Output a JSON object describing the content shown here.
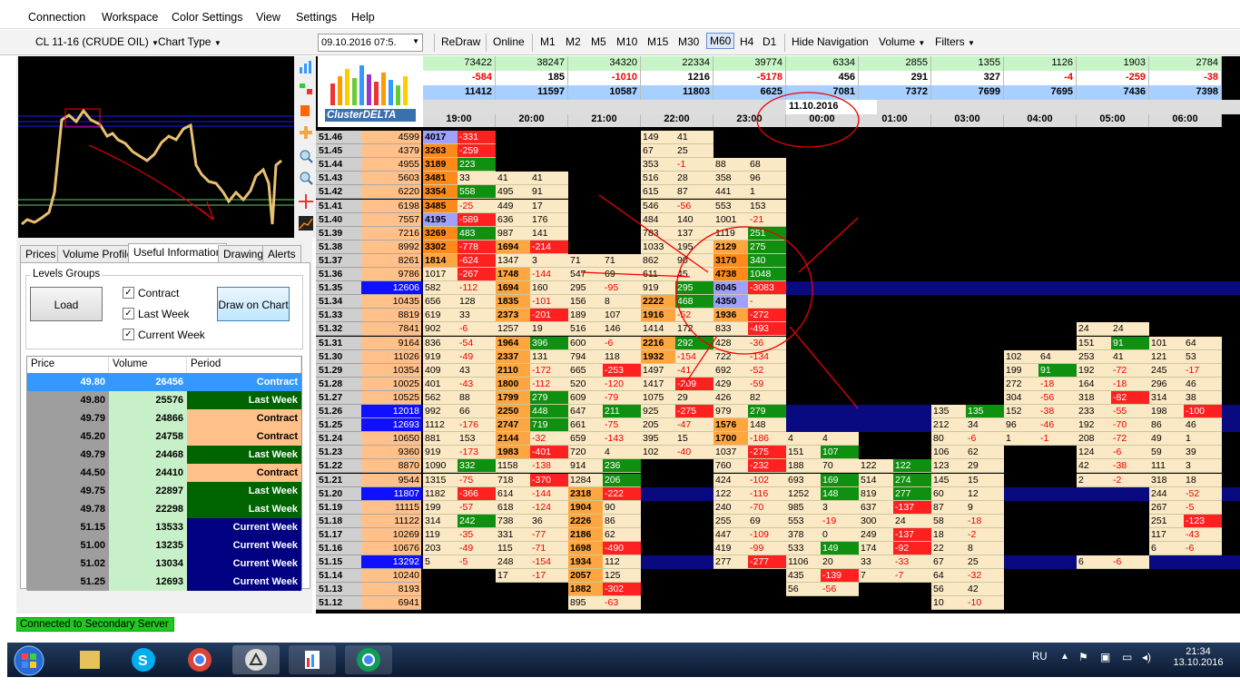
{
  "menu": [
    "Connection",
    "Workspace",
    "Color Settings",
    "View",
    "Settings",
    "Help"
  ],
  "toolbar": {
    "instrument": "CL 11-16 (CRUDE OIL)",
    "chart_type": "Chart Type",
    "date": "09.10.2016 07:5.",
    "redraw": "ReDraw",
    "online": "Online",
    "timeframes": [
      "M1",
      "M2",
      "M5",
      "M10",
      "M15",
      "M30",
      "M60",
      "H4",
      "D1"
    ],
    "hide_nav": "Hide Navigation",
    "volume": "Volume",
    "filters": "Filters"
  },
  "tabs": [
    "Prices",
    "Volume Profile",
    "Useful Information",
    "Drawing",
    "Alerts"
  ],
  "levels": {
    "group_label": "Levels Groups",
    "load": "Load",
    "draw": "Draw on Chart",
    "checks": [
      "Contract",
      "Last Week",
      "Current Week"
    ],
    "headers": [
      "Price",
      "Volume",
      "Period"
    ],
    "rows": [
      {
        "price": "49.80",
        "volume": "26456",
        "period": "Contract",
        "sel": true
      },
      {
        "price": "49.80",
        "volume": "25576",
        "period": "Last Week"
      },
      {
        "price": "49.79",
        "volume": "24866",
        "period": "Contract"
      },
      {
        "price": "45.20",
        "volume": "24758",
        "period": "Contract"
      },
      {
        "price": "49.79",
        "volume": "24468",
        "period": "Last Week"
      },
      {
        "price": "44.50",
        "volume": "24410",
        "period": "Contract"
      },
      {
        "price": "49.75",
        "volume": "22897",
        "period": "Last Week"
      },
      {
        "price": "49.78",
        "volume": "22298",
        "period": "Last Week"
      },
      {
        "price": "51.15",
        "volume": "13533",
        "period": "Current Week"
      },
      {
        "price": "51.00",
        "volume": "13235",
        "period": "Current Week"
      },
      {
        "price": "51.02",
        "volume": "13034",
        "period": "Current Week"
      },
      {
        "price": "51.25",
        "volume": "12693",
        "period": "Current Week"
      }
    ]
  },
  "status": "Connected to Secondary Server",
  "logo": "ClusterDELTA",
  "header": {
    "vol": [
      "73422",
      "38247",
      "34320",
      "22334",
      "39774",
      "6334",
      "2855",
      "1355",
      "1126",
      "1903",
      "2784"
    ],
    "delta": [
      "-584",
      "185",
      "-1010",
      "1216",
      "-5178",
      "456",
      "291",
      "327",
      "-4",
      "-259",
      "-38"
    ],
    "cum": [
      "11412",
      "11597",
      "10587",
      "11803",
      "6625",
      "7081",
      "7372",
      "7699",
      "7695",
      "7436",
      "7398"
    ],
    "date": "11.10.2016",
    "times": [
      "19:00",
      "20:00",
      "21:00",
      "22:00",
      "23:00",
      "00:00",
      "01:00",
      "03:00",
      "04:00",
      "05:00",
      "06:00"
    ]
  },
  "rows": [
    {
      "p": "51.46",
      "v": "4599"
    },
    {
      "p": "51.45",
      "v": "4379"
    },
    {
      "p": "51.44",
      "v": "4955"
    },
    {
      "p": "51.43",
      "v": "5603"
    },
    {
      "p": "51.42",
      "v": "6220"
    },
    {
      "p": "51.41",
      "v": "6198"
    },
    {
      "p": "51.40",
      "v": "7557"
    },
    {
      "p": "51.39",
      "v": "7216"
    },
    {
      "p": "51.38",
      "v": "8992"
    },
    {
      "p": "51.37",
      "v": "8261"
    },
    {
      "p": "51.36",
      "v": "9786"
    },
    {
      "p": "51.35",
      "v": "12606"
    },
    {
      "p": "51.34",
      "v": "10435"
    },
    {
      "p": "51.33",
      "v": "8819"
    },
    {
      "p": "51.32",
      "v": "7841"
    },
    {
      "p": "51.31",
      "v": "9164"
    },
    {
      "p": "51.30",
      "v": "11026"
    },
    {
      "p": "51.29",
      "v": "10354"
    },
    {
      "p": "51.28",
      "v": "10025"
    },
    {
      "p": "51.27",
      "v": "10525"
    },
    {
      "p": "51.26",
      "v": "12018"
    },
    {
      "p": "51.25",
      "v": "12693"
    },
    {
      "p": "51.24",
      "v": "10650"
    },
    {
      "p": "51.23",
      "v": "9360"
    },
    {
      "p": "51.22",
      "v": "8870"
    },
    {
      "p": "51.21",
      "v": "9544"
    },
    {
      "p": "51.20",
      "v": "11807"
    },
    {
      "p": "51.19",
      "v": "11115"
    },
    {
      "p": "51.18",
      "v": "11122"
    },
    {
      "p": "51.17",
      "v": "10269"
    },
    {
      "p": "51.16",
      "v": "10676"
    },
    {
      "p": "51.15",
      "v": "13292"
    },
    {
      "p": "51.14",
      "v": "10240"
    },
    {
      "p": "51.13",
      "v": "8193"
    },
    {
      "p": "51.12",
      "v": "6941"
    }
  ],
  "cells": [
    [
      [
        "4017",
        "-331"
      ],
      [
        "3263",
        "-259"
      ],
      [
        "3189",
        "223"
      ],
      [
        "3481",
        "33"
      ],
      [
        "3354",
        "558"
      ],
      [
        "3485",
        "-25"
      ],
      [
        "4195",
        "-589"
      ],
      [
        "3269",
        "483"
      ],
      [
        "3302",
        "-778"
      ],
      [
        "1814",
        "-624"
      ],
      [
        "1017",
        "-267"
      ],
      [
        "582",
        "-112"
      ],
      [
        "656",
        "128"
      ],
      [
        "619",
        "33"
      ],
      [
        "902",
        "-6"
      ],
      [
        "836",
        "-54"
      ],
      [
        "919",
        "-49"
      ],
      [
        "409",
        "43"
      ],
      [
        "401",
        "-43"
      ],
      [
        "562",
        "88"
      ],
      [
        "992",
        "66"
      ],
      [
        "1112",
        "-176"
      ],
      [
        "881",
        "153"
      ],
      [
        "919",
        "-173"
      ],
      [
        "1090",
        "332"
      ],
      [
        "1315",
        "-75"
      ],
      [
        "1182",
        "-366"
      ],
      [
        "199",
        "-57"
      ],
      [
        "314",
        "242"
      ],
      [
        "119",
        "-35"
      ],
      [
        "203",
        "-49"
      ],
      [
        "5",
        "-5"
      ]
    ],
    [
      null,
      null,
      null,
      [
        "41",
        "41"
      ],
      [
        "495",
        "91"
      ],
      [
        "449",
        "17"
      ],
      [
        "636",
        "176"
      ],
      [
        "987",
        "141"
      ],
      [
        "1694",
        "-214"
      ],
      [
        "1347",
        "3"
      ],
      [
        "1748",
        "-144"
      ],
      [
        "1694",
        "160"
      ],
      [
        "1835",
        "-101"
      ],
      [
        "2373",
        "-201"
      ],
      [
        "1257",
        "19"
      ],
      [
        "1964",
        "396"
      ],
      [
        "2337",
        "131"
      ],
      [
        "2110",
        "-172"
      ],
      [
        "1800",
        "-112"
      ],
      [
        "1799",
        "279"
      ],
      [
        "2250",
        "448"
      ],
      [
        "2747",
        "719"
      ],
      [
        "2144",
        "-32"
      ],
      [
        "1983",
        "-401"
      ],
      [
        "1158",
        "-138"
      ],
      [
        "718",
        "-370"
      ],
      [
        "614",
        "-144"
      ],
      [
        "618",
        "-124"
      ],
      [
        "738",
        "36"
      ],
      [
        "331",
        "-77"
      ],
      [
        "115",
        "-71"
      ],
      [
        "248",
        "-154"
      ],
      [
        "17",
        "-17"
      ]
    ],
    [
      null,
      null,
      null,
      null,
      null,
      null,
      null,
      null,
      null,
      [
        "71",
        "71"
      ],
      [
        "547",
        "69"
      ],
      [
        "295",
        "-95"
      ],
      [
        "156",
        "8"
      ],
      [
        "189",
        "107"
      ],
      [
        "516",
        "146"
      ],
      [
        "600",
        "-6"
      ],
      [
        "794",
        "118"
      ],
      [
        "665",
        "-253"
      ],
      [
        "520",
        "-120"
      ],
      [
        "609",
        "-79"
      ],
      [
        "647",
        "211"
      ],
      [
        "661",
        "-75"
      ],
      [
        "659",
        "-143"
      ],
      [
        "720",
        "4"
      ],
      [
        "914",
        "236"
      ],
      [
        "1284",
        "206"
      ],
      [
        "2318",
        "-222"
      ],
      [
        "1904",
        "90"
      ],
      [
        "2226",
        "86"
      ],
      [
        "2186",
        "62"
      ],
      [
        "1698",
        "-490"
      ],
      [
        "1934",
        "112"
      ],
      [
        "2057",
        "125"
      ],
      [
        "1882",
        "-302"
      ],
      [
        "895",
        "-63"
      ]
    ],
    [
      [
        "149",
        "41"
      ],
      [
        "67",
        "25"
      ],
      [
        "353",
        "-1"
      ],
      [
        "516",
        "28"
      ],
      [
        "615",
        "87"
      ],
      [
        "546",
        "-56"
      ],
      [
        "484",
        "140"
      ],
      [
        "783",
        "137"
      ],
      [
        "1033",
        "195"
      ],
      [
        "862",
        "90"
      ],
      [
        "611",
        "45"
      ],
      [
        "919",
        "295"
      ],
      [
        "2222",
        "468"
      ],
      [
        "1916",
        "-52"
      ],
      [
        "1414",
        "172"
      ],
      [
        "2216",
        "292"
      ],
      [
        "1932",
        "-154"
      ],
      [
        "1497",
        "-41"
      ],
      [
        "1417",
        "-209"
      ],
      [
        "1075",
        "29"
      ],
      [
        "925",
        "-275"
      ],
      [
        "205",
        "-47"
      ],
      [
        "395",
        "15"
      ],
      [
        "102",
        "-40"
      ]
    ],
    [
      null,
      null,
      [
        "88",
        "68"
      ],
      [
        "358",
        "96"
      ],
      [
        "441",
        "1"
      ],
      [
        "553",
        "153"
      ],
      [
        "1001",
        "-21"
      ],
      [
        "1119",
        "251"
      ],
      [
        "2129",
        "275"
      ],
      [
        "3170",
        "340"
      ],
      [
        "4738",
        "1048"
      ],
      [
        "8045",
        "-3083"
      ],
      [
        "4350",
        "-"
      ],
      [
        "1936",
        "-272"
      ],
      [
        "833",
        "-493"
      ],
      [
        "428",
        "-36"
      ],
      [
        "722",
        "-134"
      ],
      [
        "692",
        "-52"
      ],
      [
        "429",
        "-59"
      ],
      [
        "426",
        "82"
      ],
      [
        "979",
        "279"
      ],
      [
        "1576",
        "148"
      ],
      [
        "1700",
        "-186"
      ],
      [
        "1037",
        "-275"
      ],
      [
        "760",
        "-232"
      ],
      [
        "424",
        "-102"
      ],
      [
        "122",
        "-116"
      ],
      [
        "240",
        "-70"
      ],
      [
        "255",
        "69"
      ],
      [
        "447",
        "-109"
      ],
      [
        "419",
        "-99"
      ],
      [
        "277",
        "-277"
      ]
    ]
  ],
  "rcells": [
    {
      "col": 5,
      "items": [
        [
          22,
          "4",
          "4"
        ],
        [
          23,
          "151",
          "107"
        ],
        [
          24,
          "188",
          "70"
        ],
        [
          25,
          "693",
          "169"
        ],
        [
          26,
          "1252",
          "148"
        ],
        [
          27,
          "985",
          "3"
        ],
        [
          28,
          "553",
          "-19"
        ],
        [
          29,
          "378",
          "0"
        ],
        [
          30,
          "533",
          "149"
        ],
        [
          31,
          "1106",
          "20"
        ],
        [
          32,
          "435",
          "-139"
        ],
        [
          33,
          "56",
          "-56"
        ]
      ]
    },
    {
      "col": 6,
      "items": [
        [
          24,
          "122",
          "122"
        ],
        [
          25,
          "514",
          "274"
        ],
        [
          26,
          "819",
          "277"
        ],
        [
          27,
          "637",
          "-137"
        ],
        [
          28,
          "300",
          "24"
        ],
        [
          29,
          "249",
          "-137"
        ],
        [
          30,
          "174",
          "-92"
        ],
        [
          31,
          "33",
          "-33"
        ],
        [
          32,
          "7",
          "-7"
        ]
      ]
    },
    {
      "col": 7,
      "items": [
        [
          20,
          "135",
          "135"
        ],
        [
          21,
          "212",
          "34"
        ],
        [
          22,
          "80",
          "-6"
        ],
        [
          23,
          "106",
          "62"
        ],
        [
          24,
          "123",
          "29"
        ],
        [
          25,
          "145",
          "15"
        ],
        [
          26,
          "60",
          "12"
        ],
        [
          27,
          "87",
          "9"
        ],
        [
          28,
          "58",
          "-18"
        ],
        [
          29,
          "18",
          "-2"
        ],
        [
          30,
          "22",
          "8"
        ],
        [
          31,
          "67",
          "25"
        ],
        [
          32,
          "64",
          "-32"
        ],
        [
          33,
          "56",
          "42"
        ],
        [
          34,
          "10",
          "-10"
        ]
      ]
    },
    {
      "col": 8,
      "items": [
        [
          16,
          "102",
          "64"
        ],
        [
          17,
          "199",
          "91"
        ],
        [
          18,
          "272",
          "-18"
        ],
        [
          19,
          "304",
          "-56"
        ],
        [
          20,
          "152",
          "-38"
        ],
        [
          21,
          "96",
          "-46"
        ],
        [
          22,
          "1",
          "-1"
        ]
      ]
    },
    {
      "col": 9,
      "items": [
        [
          14,
          "24",
          "24"
        ],
        [
          15,
          "151",
          "91"
        ],
        [
          16,
          "253",
          "41"
        ],
        [
          17,
          "192",
          "-72"
        ],
        [
          18,
          "164",
          "-18"
        ],
        [
          19,
          "318",
          "-82"
        ],
        [
          20,
          "233",
          "-55"
        ],
        [
          21,
          "192",
          "-70"
        ],
        [
          22,
          "208",
          "-72"
        ],
        [
          23,
          "124",
          "-6"
        ],
        [
          24,
          "42",
          "-38"
        ],
        [
          25,
          "2",
          "-2"
        ],
        [
          31,
          "6",
          "-6"
        ]
      ]
    },
    {
      "col": 10,
      "items": [
        [
          15,
          "101",
          "64"
        ],
        [
          16,
          "121",
          "53"
        ],
        [
          17,
          "245",
          "-17"
        ],
        [
          18,
          "296",
          "46"
        ],
        [
          19,
          "314",
          "38"
        ],
        [
          20,
          "198",
          "-100"
        ],
        [
          21,
          "86",
          "46"
        ],
        [
          22,
          "49",
          "1"
        ],
        [
          23,
          "59",
          "39"
        ],
        [
          24,
          "111",
          "3"
        ],
        [
          25,
          "318",
          "18"
        ],
        [
          26,
          "244",
          "-52"
        ],
        [
          27,
          "267",
          "-5"
        ],
        [
          28,
          "251",
          "-123"
        ],
        [
          29,
          "117",
          "-43"
        ],
        [
          30,
          "6",
          "-6"
        ]
      ]
    }
  ],
  "tray": {
    "lang": "RU",
    "time": "21:34",
    "date": "13.10.2016"
  },
  "colors": {
    "accent_blue": "#3399ff",
    "last_week_green": "#006400",
    "contract_orange": "#ffc08a",
    "current_week_navy": "#000080"
  }
}
